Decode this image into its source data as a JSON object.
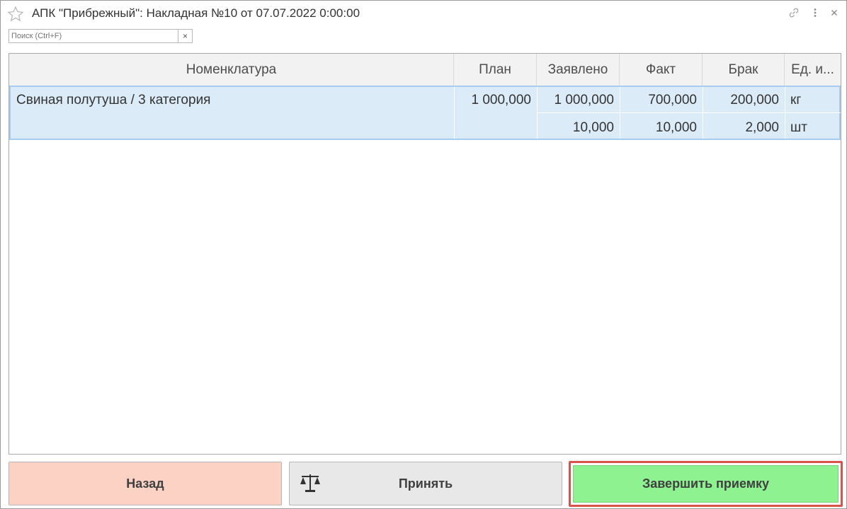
{
  "window": {
    "title": "АПК \"Прибрежный\": Накладная №10 от 07.07.2022 0:00:00",
    "icons": [
      "star-icon",
      "link-icon",
      "more-icon",
      "close-icon"
    ]
  },
  "search": {
    "placeholder": "Поиск (Ctrl+F)",
    "clear_label": "×"
  },
  "table": {
    "columns": [
      "Номенклатура",
      "План",
      "Заявлено",
      "Факт",
      "Брак",
      "Ед. и..."
    ],
    "rows": [
      {
        "name": "Свиная полутуша / 3 категория",
        "plan": "1 000,000",
        "lines": [
          {
            "declared": "1 000,000",
            "fact": "700,000",
            "defect": "200,000",
            "unit": "кг"
          },
          {
            "declared": "10,000",
            "fact": "10,000",
            "defect": "2,000",
            "unit": "шт"
          }
        ]
      }
    ]
  },
  "buttons": {
    "back": "Назад",
    "accept": "Принять",
    "finish": "Завершить приемку"
  },
  "colors": {
    "selected_row": "#dcebf8",
    "back_button": "#fbd2c3",
    "finish_button": "#8ef290",
    "highlight_border": "#d9534a"
  }
}
